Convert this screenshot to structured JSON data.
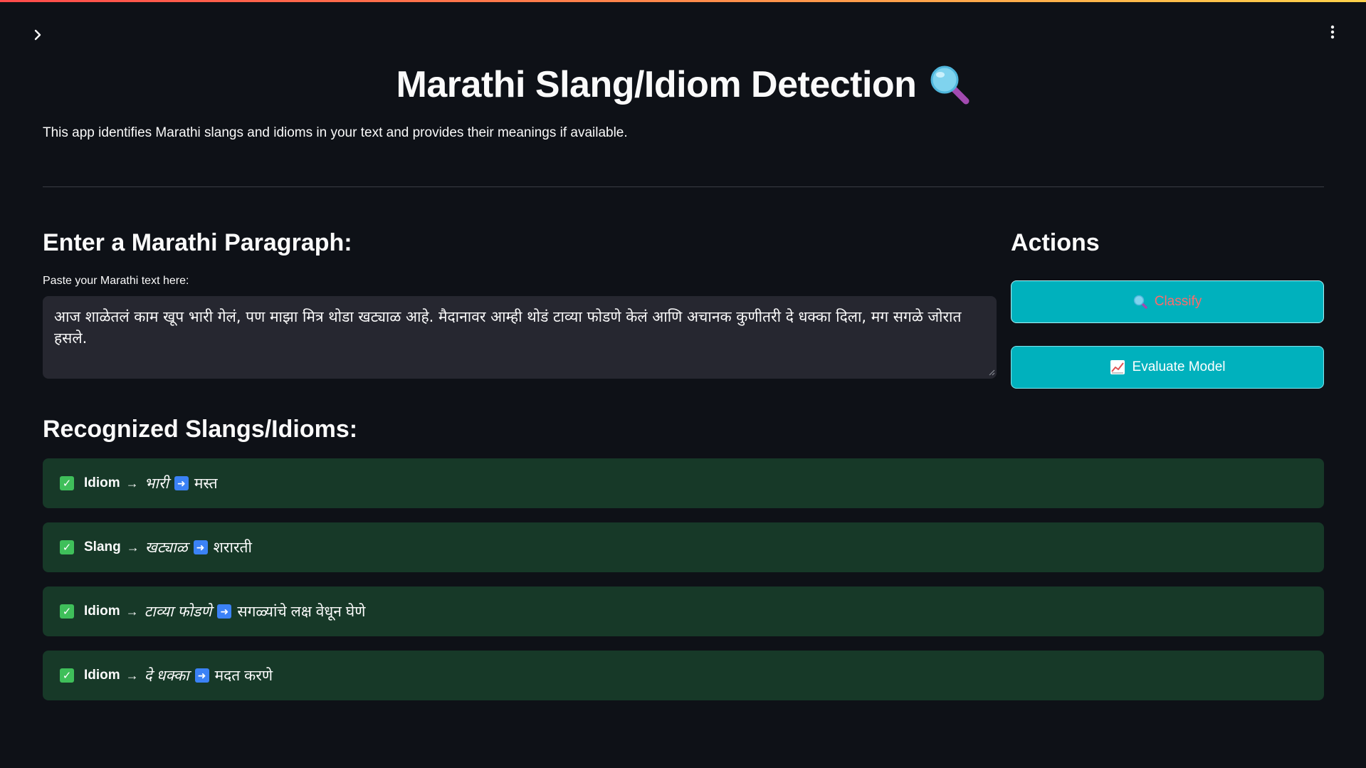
{
  "app": {
    "title": "Marathi Slang/Idiom Detection",
    "subtitle": "This app identifies Marathi slangs and idioms in your text and provides their meanings if available.",
    "title_icon": "magnifier-icon"
  },
  "input": {
    "heading": "Enter a Marathi Paragraph:",
    "label": "Paste your Marathi text here:",
    "value": "आज शाळेतलं काम खूप भारी गेलं, पण माझा मित्र थोडा खट्याळ आहे. मैदानावर आम्ही थोडं टाव्या फोडणे केलं आणि अचानक कुणीतरी दे धक्का दिला, मग सगळे जोरात हसले."
  },
  "actions": {
    "heading": "Actions",
    "classify_label": "Classify",
    "classify_icon": "magnifier-icon",
    "evaluate_label": "Evaluate Model",
    "evaluate_icon": "chart-icon"
  },
  "results": {
    "heading": "Recognized Slangs/Idioms:",
    "items": [
      {
        "type": "Idiom",
        "phrase": "भारी",
        "meaning": "मस्त"
      },
      {
        "type": "Slang",
        "phrase": "खट्याळ",
        "meaning": "शरारती"
      },
      {
        "type": "Idiom",
        "phrase": "टाव्या फोडणे",
        "meaning": "सगळ्यांचे लक्ष वेधून घेणे"
      },
      {
        "type": "Idiom",
        "phrase": "दे धक्का",
        "meaning": "मदत करणे"
      }
    ]
  },
  "colors": {
    "background": "#0e1117",
    "accent_button": "#00b1bd",
    "result_bg": "#173928",
    "textarea_bg": "#262730"
  }
}
